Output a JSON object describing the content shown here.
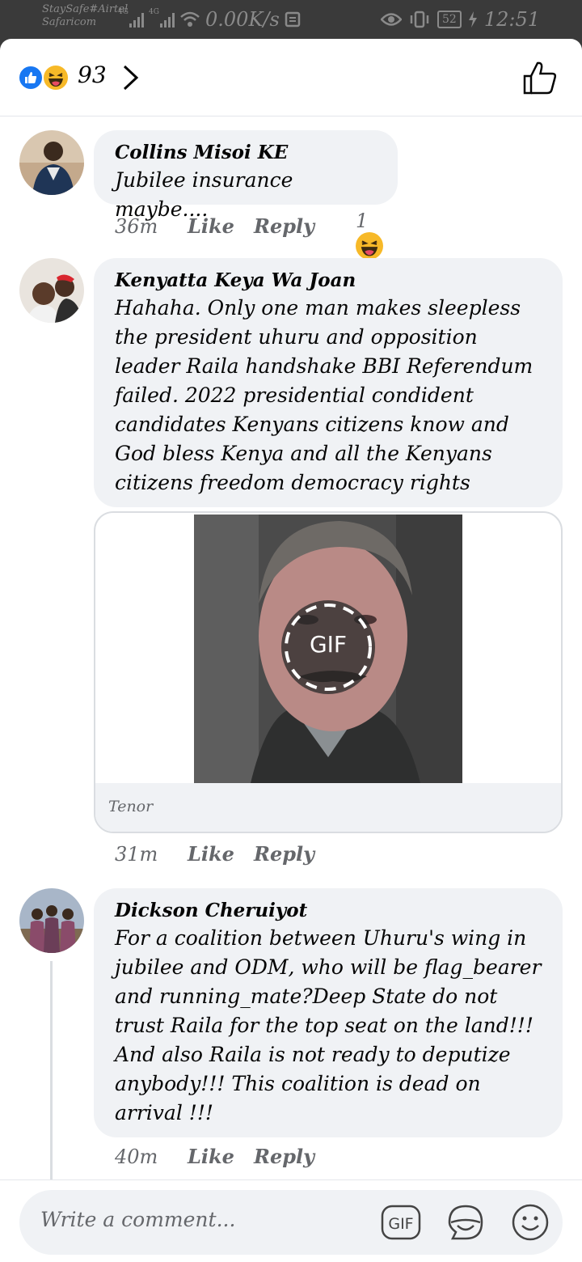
{
  "status_bar": {
    "carrier_1": "StaySafe#Airtel",
    "carrier_2": "Safaricom",
    "net_label_1": "4G",
    "net_label_2": "4G",
    "speed": "0.00K/s",
    "battery": "52",
    "time": "12:51"
  },
  "reactions_bar": {
    "count": "93",
    "icons": [
      "like-reaction",
      "haha-reaction"
    ]
  },
  "comments": [
    {
      "author": "Collins Misoi KE",
      "text": "Jubilee insurance maybe....",
      "time": "36m",
      "like_label": "Like",
      "reply_label": "Reply",
      "reaction_count": "1"
    },
    {
      "author": "Kenyatta Keya Wa Joan",
      "text": "Hahaha. Only one man makes sleepless the president uhuru and opposition leader Raila handshake BBI Referendum failed. 2022 presidential condident candidates Kenyans citizens know and God bless Kenya and all the Kenyans citizens freedom democracy rights",
      "gif_label": "GIF",
      "gif_source": "Tenor",
      "time": "31m",
      "like_label": "Like",
      "reply_label": "Reply"
    },
    {
      "author": "Dickson Cheruiyot",
      "text": "For a coalition between Uhuru's wing in jubilee and ODM, who will be flag_bearer and running_mate?Deep State do not trust Raila for the top seat on the land!!! And also Raila is not ready to deputize anybody!!! This coalition is dead on arrival !!!",
      "time": "40m",
      "like_label": "Like",
      "reply_label": "Reply"
    }
  ],
  "composer": {
    "placeholder": "Write a comment...",
    "gif_button_label": "GIF"
  },
  "colors": {
    "brand_blue": "#1877f2",
    "bubble_bg": "#f0f2f5",
    "meta_gray": "#65676b",
    "haha_yellow": "#f7b928"
  }
}
